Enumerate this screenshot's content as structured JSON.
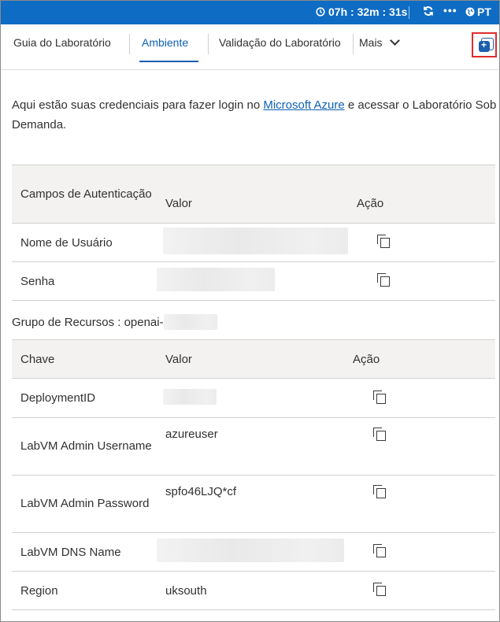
{
  "topbar": {
    "timer": "07h : 32m : 31s",
    "language": "PT",
    "background": "#0e6cc4"
  },
  "tabs": [
    {
      "label": "Guia do Laboratório",
      "active": false
    },
    {
      "label": "Ambiente",
      "active": true
    },
    {
      "label": "Validação do Laboratório",
      "active": false
    },
    {
      "label": "Mais",
      "active": false
    }
  ],
  "intro": {
    "before": "Aqui estão suas credenciais para fazer login no ",
    "link": "Microsoft Azure",
    "after": " e acessar o Laboratório Sob Demanda."
  },
  "auth_table": {
    "headers": [
      "Campos de Autenticação",
      "Valor",
      "Ação"
    ],
    "rows": [
      {
        "label": "Nome de Usuário",
        "value": ""
      },
      {
        "label": "Senha",
        "value": ""
      }
    ]
  },
  "resource_group": {
    "label": "Grupo de Recursos : openai-"
  },
  "resource_table": {
    "headers": [
      "Chave",
      "Valor",
      "Ação"
    ],
    "rows": [
      {
        "label": "DeploymentID",
        "value": ""
      },
      {
        "label": "LabVM Admin Username",
        "value": "azureuser"
      },
      {
        "label": "LabVM Admin Password",
        "value": "spfo46LJQ*cf"
      },
      {
        "label": "LabVM DNS Name",
        "value": ""
      },
      {
        "label": "Region",
        "value": "uksouth"
      }
    ]
  },
  "accent_color": "#0e5fb3",
  "highlight_color": "#e02b2b"
}
